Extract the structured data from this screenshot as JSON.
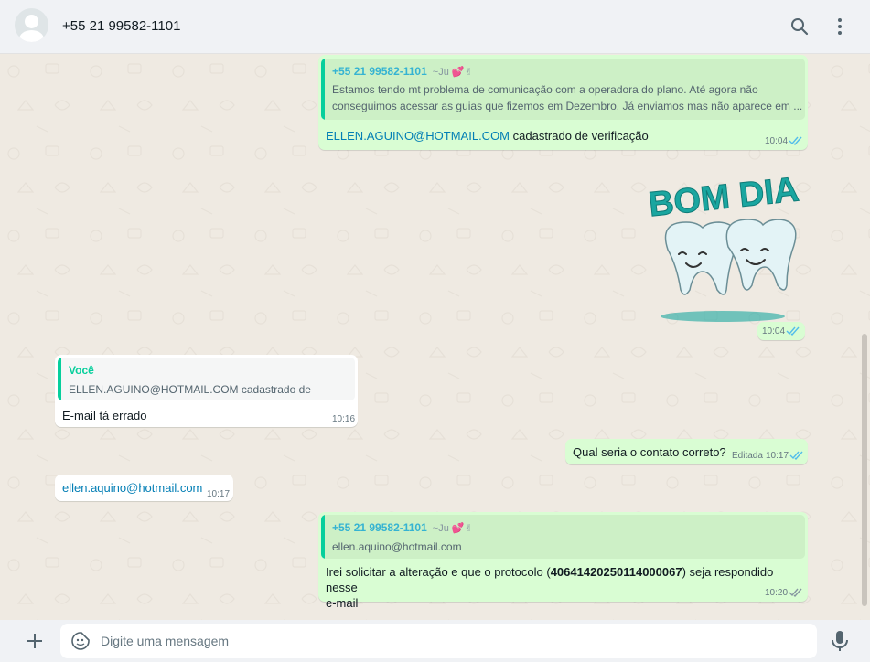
{
  "header": {
    "contact": "+55 21 99582-1101",
    "icons": [
      "search-icon",
      "menu-dots-icon"
    ]
  },
  "messages": [
    {
      "id": "m1",
      "direction": "outgoing",
      "quote": {
        "author": "+55 21 99582-1101",
        "author_alias": "~Ju 💕✌",
        "line1": "Estamos tendo mt problema de comunicação com a operadora do plano. Até agora não",
        "line2": "conseguimos acessar as guias que fizemos em Dezembro. Já enviamos mas não aparece em ..."
      },
      "link": "ELLEN.AGUINO@HOTMAIL.COM",
      "text": " cadastrado de verificação",
      "time": "10:04"
    },
    {
      "id": "m2",
      "direction": "outgoing",
      "type": "sticker",
      "sticker_text": "BOM DIA",
      "time": "10:04"
    },
    {
      "id": "m3",
      "direction": "incoming",
      "quote": {
        "author": "Você",
        "line1": "ELLEN.AGUINO@HOTMAIL.COM cadastrado de verificação"
      },
      "text": "E-mail tá errado",
      "time": "10:16"
    },
    {
      "id": "m4",
      "direction": "outgoing",
      "text": "Qual seria o contato correto?",
      "edited": "Editada",
      "time": "10:17"
    },
    {
      "id": "m5",
      "direction": "incoming",
      "link": "ellen.aquino@hotmail.com",
      "time": "10:17"
    },
    {
      "id": "m6",
      "direction": "outgoing",
      "quote": {
        "author": "+55 21 99582-1101",
        "author_alias": "~Ju 💕✌",
        "line1": "ellen.aquino@hotmail.com"
      },
      "text_before": "Irei solicitar a alteração e que o protocolo (",
      "text_bold": "40641420250114000067",
      "text_after": ") seja respondido nesse",
      "text_line2": "e-mail",
      "time": "10:20"
    }
  ],
  "composer": {
    "placeholder": "Digite uma mensagem",
    "icons": [
      "plus-icon",
      "sticker-icon",
      "microphone-icon"
    ]
  },
  "colors": {
    "outgoing_bubble": "#d9fdd3",
    "incoming_bubble": "#ffffff",
    "chat_background": "#efeae2",
    "header_background": "#f0f2f5",
    "read_ticks": "#53bdeb",
    "link": "#027eb5",
    "quote_author_contact": "#35cd96",
    "quote_author_you": "#06cf9c"
  }
}
